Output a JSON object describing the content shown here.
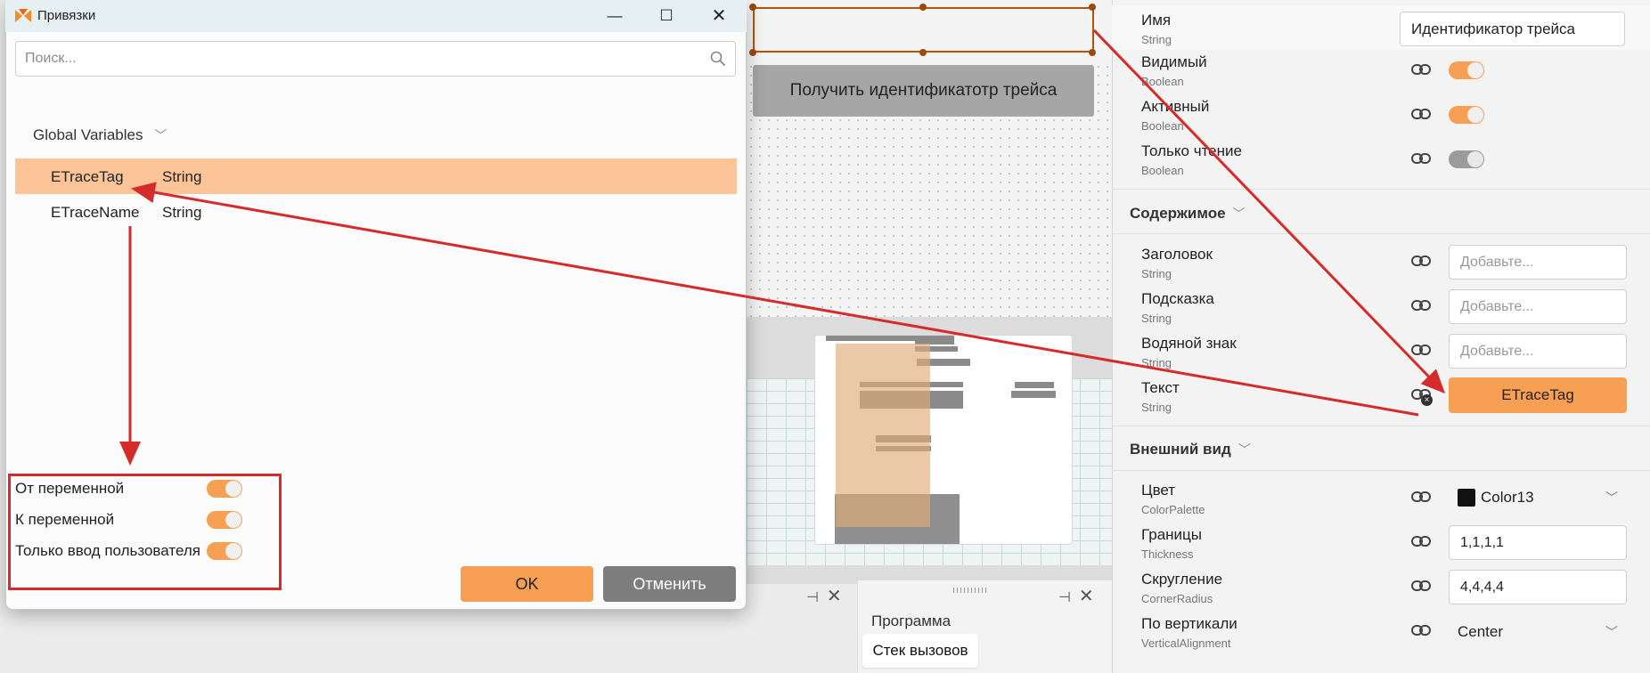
{
  "dialog": {
    "title": "Привязки",
    "search": {
      "placeholder": "Поиск...",
      "value": ""
    },
    "group": {
      "label": "Global Variables"
    },
    "variables": [
      {
        "name": "ETraceTag",
        "type": "String",
        "selected": true
      },
      {
        "name": "ETraceName",
        "type": "String",
        "selected": false
      }
    ],
    "options": [
      {
        "label": "От переменной",
        "on": true
      },
      {
        "label": "К переменной",
        "on": true
      },
      {
        "label": "Только ввод пользователя",
        "on": true
      }
    ],
    "ok_label": "OK",
    "cancel_label": "Отменить"
  },
  "designer": {
    "get_id_button_label": "Получить идентификатотр трейса"
  },
  "bottom_panel": {
    "tab_program": "Программа",
    "tab_callstack": "Стек вызовов"
  },
  "properties": {
    "name_row": {
      "name": "Имя",
      "type": "String",
      "value": "Идентификатор трейса"
    },
    "visible_row": {
      "name": "Видимый",
      "type": "Boolean",
      "on": true
    },
    "active_row": {
      "name": "Активный",
      "type": "Boolean",
      "on": true
    },
    "readonly_row": {
      "name": "Только чтение",
      "type": "Boolean",
      "on": false
    },
    "content_section": "Содержимое",
    "header_row": {
      "name": "Заголовок",
      "type": "String",
      "placeholder": "Добавьте..."
    },
    "hint_row": {
      "name": "Подсказка",
      "type": "String",
      "placeholder": "Добавьте..."
    },
    "watermark_row": {
      "name": "Водяной знак",
      "type": "String",
      "placeholder": "Добавьте..."
    },
    "text_row": {
      "name": "Текст",
      "type": "String",
      "binding": "ETraceTag"
    },
    "appearance_section": "Внешний вид",
    "color_row": {
      "name": "Цвет",
      "type": "ColorPalette",
      "value": "Color13"
    },
    "border_row": {
      "name": "Границы",
      "type": "Thickness",
      "value": "1,1,1,1"
    },
    "corner_row": {
      "name": "Скругление",
      "type": "CornerRadius",
      "value": "4,4,4,4"
    },
    "valign_row": {
      "name": "По вертикали",
      "type": "VerticalAlignment",
      "value": "Center"
    }
  },
  "colors": {
    "accent_orange": "#f79f52",
    "selection_row": "#fdc597",
    "annotation_red": "#d62b2b"
  }
}
